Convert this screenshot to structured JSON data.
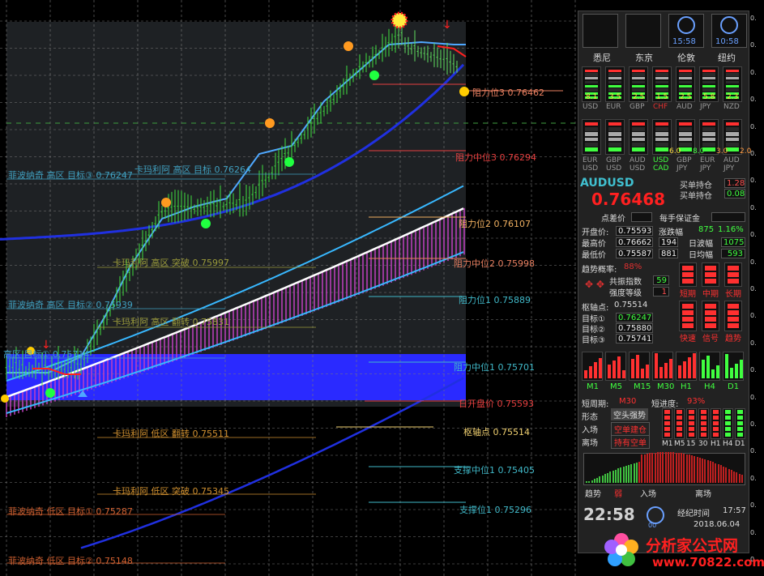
{
  "chart_levels": [
    {
      "text": "阻力位3 0.76462",
      "color": "#e87f60"
    },
    {
      "text": "阻力中位3 0.76294",
      "color": "#e84040"
    },
    {
      "text": "阻力位2 0.76107",
      "color": "#f0b060"
    },
    {
      "text": "阻力中位2 0.75998",
      "color": "#e87f60"
    },
    {
      "text": "阻力位1 0.75889",
      "color": "#40b8c8"
    },
    {
      "text": "阻力中位1 0.75701",
      "color": "#40b8c8"
    },
    {
      "text": "日开盘价 0.75593",
      "color": "#e84040"
    },
    {
      "text": "枢轴点 0.75514",
      "color": "#f0d070"
    },
    {
      "text": "支撑中位1 0.75405",
      "color": "#40b8c8"
    },
    {
      "text": "支撑位1 0.75296",
      "color": "#40b8c8"
    }
  ],
  "fib_labels": [
    {
      "text": "菲波纳奇 高区 目标③ 0.76247",
      "color": "#40a0c0"
    },
    {
      "text": "卡玛利阿 高区 目标 0.76264",
      "color": "#40a0c0"
    },
    {
      "text": "卡玛利阿 高区 突破 0.75997",
      "color": "#9a9a3a"
    },
    {
      "text": "菲波纳奇 高区 目标② 0.75939",
      "color": "#40a0c0"
    },
    {
      "text": "卡玛利阿 高区 翻转 0.75831",
      "color": "#9a9a3a"
    },
    {
      "text": "高区 目标① 0.75714",
      "color": "#40a0c0"
    },
    {
      "text": "卡玛利阿 低区 翻转 0.75511",
      "color": "#d09030"
    },
    {
      "text": "卡玛利阿 低区 突破 0.75345",
      "color": "#d09030"
    },
    {
      "text": "菲波纳奇 低区 目标① 0.75287",
      "color": "#d06030"
    },
    {
      "text": "菲波纳奇 低区 目标② 0.75148",
      "color": "#d06030"
    }
  ],
  "panel": {
    "cities": [
      "悉尼",
      "东京",
      "伦敦",
      "纽约"
    ],
    "clock_london": "15:58",
    "clock_newyork": "10:58",
    "currency_row1": {
      "values": [
        "8.1",
        "3.5",
        "2.5",
        "1.5",
        "2.5",
        "5.8",
        "2.3"
      ],
      "codes": [
        "USD",
        "EUR",
        "GBP",
        "CHF",
        "AUD",
        "JPY",
        "NZD"
      ],
      "code_colors": [
        "#999",
        "#999",
        "#999",
        "#e03030",
        "#999",
        "#999",
        "#999"
      ]
    },
    "currency_row2": {
      "values": [
        "",
        "",
        "",
        "",
        "6.0",
        "",
        "8.0",
        "",
        "3.0",
        "",
        "2.0"
      ],
      "top": [
        "EUR",
        "GBP",
        "AUD",
        "USD",
        "GBP",
        "EUR",
        "AUD"
      ],
      "bottom": [
        "USD",
        "USD",
        "USD",
        "CAD",
        "JPY",
        "JPY",
        "JPY"
      ]
    },
    "symbol": "AUDUSD",
    "price": "0.76468",
    "buy_label": "买单持仓",
    "buy_value": "1.28",
    "sell_label": "买单持仓",
    "sell_value": "0.08",
    "spread_label": "点差价",
    "margin_label": "每手保证金",
    "open_label": "开盘价:",
    "open_value": "0.75593",
    "change_label": "涨跌幅",
    "change_points": "875",
    "change_pct": "1.16%",
    "high_label": "最高价",
    "high_value": "0.76662",
    "high_pts": "194",
    "range_label": "日波幅",
    "range_value": "1075",
    "low_label": "最低价",
    "low_value": "0.75587",
    "low_pts": "881",
    "avg_label": "日均幅",
    "avg_value": "593",
    "trend_label": "趋势概率:",
    "trend_value": "88%",
    "resonance_label": "共振指数",
    "resonance_value": "59",
    "strength_label": "强度等级",
    "strength_value": "1",
    "term_labels": [
      "短期",
      "中期",
      "长期"
    ],
    "pivot_label": "枢轴点:",
    "pivot_value": "0.75514",
    "targets": [
      {
        "label": "目标①",
        "value": "0.76247"
      },
      {
        "label": "目标②",
        "value": "0.75880"
      },
      {
        "label": "目标③",
        "value": "0.75741"
      }
    ],
    "signal_labels": [
      "快速",
      "信号",
      "趋势"
    ],
    "tf_labels": [
      "M1",
      "M5",
      "M15",
      "M30",
      "H1",
      "H4",
      "D1"
    ],
    "period_label": "短周期:",
    "period_value": "M30",
    "progress_label": "短进度:",
    "progress_value": "93%",
    "form_label": "形态",
    "form_value": "空头强势",
    "entry_label": "入场",
    "entry_value": "空单建仓",
    "exit_label": "离场",
    "exit_value": "持有空单",
    "tf_labels2": [
      "M1",
      "M5",
      "15",
      "30",
      "H1",
      "H4",
      "D1"
    ],
    "trend_bottom": "趋势",
    "trend_bottom_value": "弱",
    "entry_bottom": "入场",
    "exit_bottom": "离场",
    "time": "22:58",
    "count_small": "00",
    "broker_label": "经纪时间",
    "broker_time": "17:57",
    "date": "2018.06.04"
  },
  "axis_labels": [
    "0.",
    "0.",
    "0.",
    "0.",
    "0.",
    "0.",
    "0.",
    "0.",
    "0.",
    "0.",
    "0.",
    "0.",
    "0.",
    "0.",
    "0.",
    "0.",
    "0.",
    "0.",
    "0.",
    "0.",
    "0."
  ],
  "watermark": {
    "text": "分析家公式网",
    "url": "www.70822.com"
  }
}
